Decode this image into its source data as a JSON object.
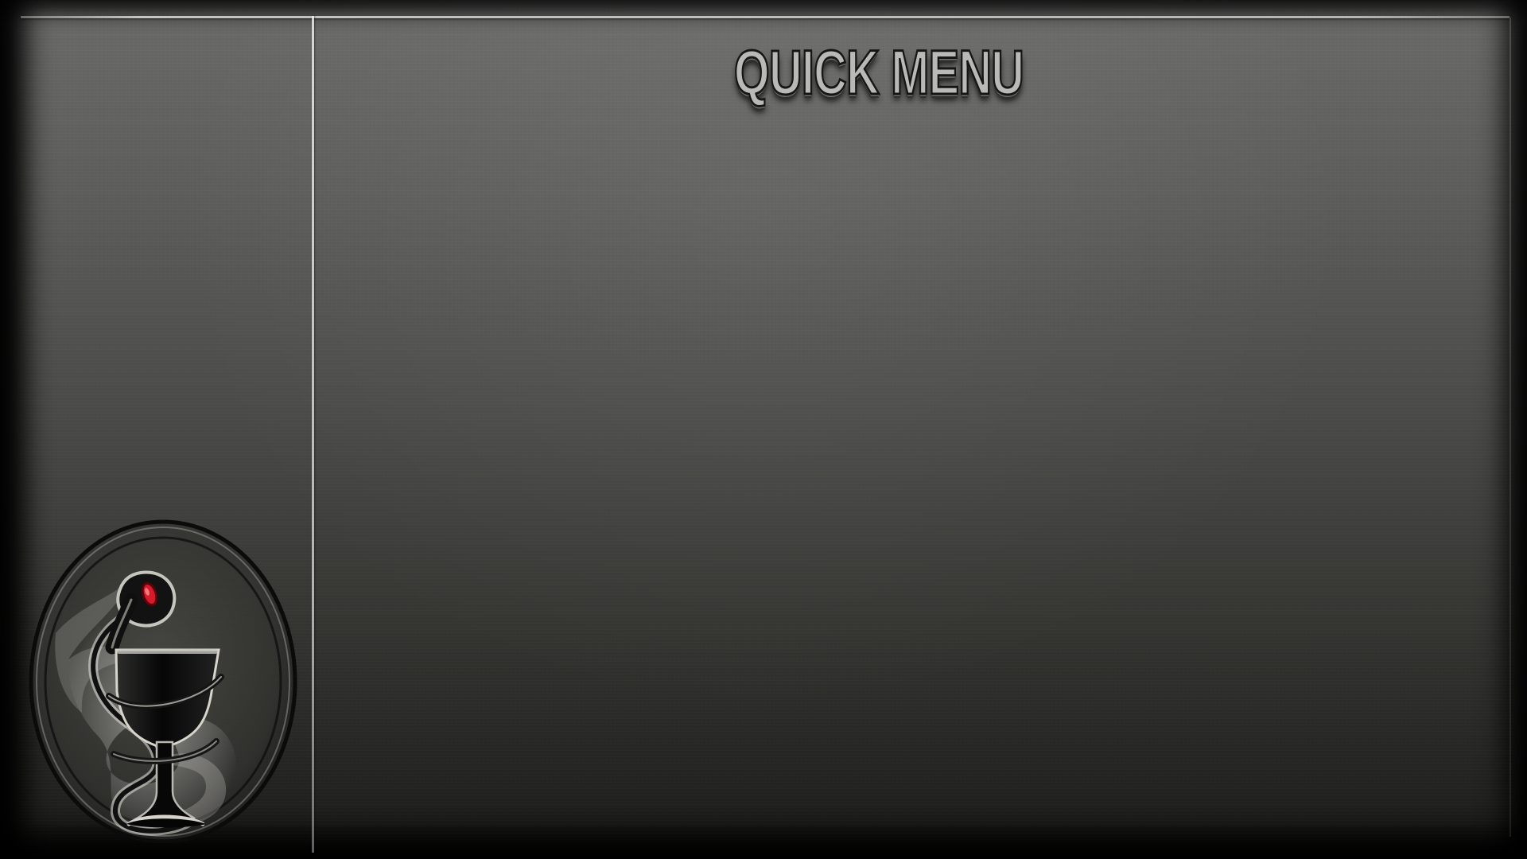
{
  "screen": {
    "title": "QUICK MENU"
  },
  "emblem": {
    "icon": "serpent-goblet-emblem-icon",
    "accent_color": "#d51b2c"
  },
  "theme": {
    "background_top": "#6a6a69",
    "background_bottom": "#1b1b19",
    "divider_color": "#e3e3e3",
    "title_color": "#b9b9b8"
  }
}
